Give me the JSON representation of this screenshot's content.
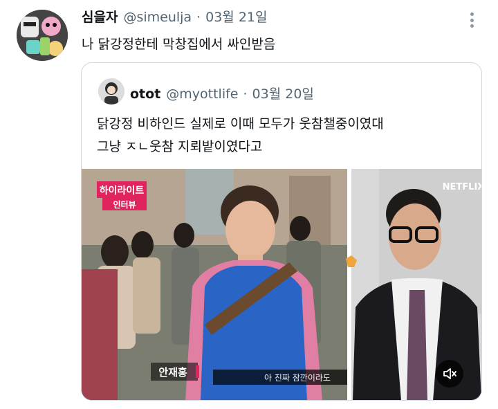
{
  "tweet": {
    "author_name": "심을자",
    "author_handle": "@simeulja",
    "separator": "·",
    "date": "03월 21일",
    "text": "나 닭강정한테 막창집에서 싸인받음"
  },
  "quoted_tweet": {
    "author_name": "otot",
    "author_handle": "@myottlife",
    "separator": "·",
    "date": "03월 20일",
    "text_lines": [
      "닭강정 비하인드 실제로 이때 모두가 웃참챌중이였대",
      "그냥 ㅈㄴ웃참 지뢰밭이였다고"
    ]
  },
  "media": {
    "badge_line1": "하이라이트",
    "badge_line2": "인터뷰",
    "watermark": "NETFLIX",
    "name_caption": "안재홍",
    "subtitle": "아 진짜 잠깐이라도"
  },
  "icons": {
    "more": "more-options-icon",
    "mute": "volume-mute-icon"
  },
  "colors": {
    "text": "#0f1419",
    "secondary": "#536471",
    "border": "#cfd9de",
    "badge": "#e0245e"
  }
}
